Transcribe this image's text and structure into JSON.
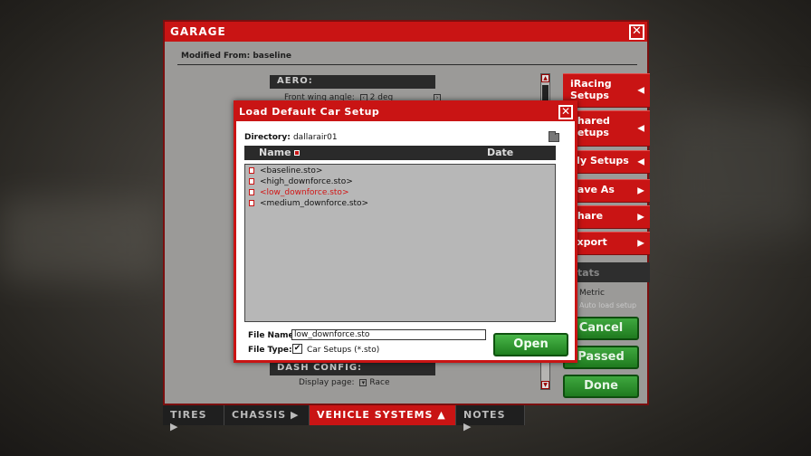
{
  "garage": {
    "title": "GARAGE",
    "modified_from": "Modified From: baseline",
    "aero_header": "AERO:",
    "front_wing_label": "Front wing angle:",
    "front_wing_value": "2 deg",
    "dash_header": "DASH CONFIG:",
    "display_page_label": "Display page:",
    "display_page_value": "Race"
  },
  "side_menu": {
    "iracing_setups": "iRacing Setups",
    "shared_setups": "Shared Setups",
    "my_setups": "My Setups",
    "save_as": "Save As",
    "share": "Share",
    "export": "Export",
    "stats": "Stats",
    "metric": "Metric",
    "auto_load": "Auto load setup",
    "cancel": "Cancel",
    "passed": "Passed",
    "done": "Done"
  },
  "tabs": [
    "TIRES",
    "CHASSIS",
    "VEHICLE SYSTEMS",
    "NOTES"
  ],
  "dialog": {
    "title": "Load Default Car Setup",
    "directory_label": "Directory:",
    "directory_value": "dallarair01",
    "col_name": "Name",
    "col_date": "Date",
    "files": [
      "<baseline.sto>",
      "<high_downforce.sto>",
      "<low_downforce.sto>",
      "<medium_downforce.sto>"
    ],
    "selected_index": 2,
    "file_name_label": "File Name:",
    "file_name_value": "low_downforce.sto",
    "file_type_label": "File Type:",
    "file_type_value": "Car Setups (*.sto)",
    "open_label": "Open"
  },
  "colors": {
    "accent_red": "#c91414",
    "button_green": "#2e8f2e",
    "selected_text": "#d21515"
  }
}
